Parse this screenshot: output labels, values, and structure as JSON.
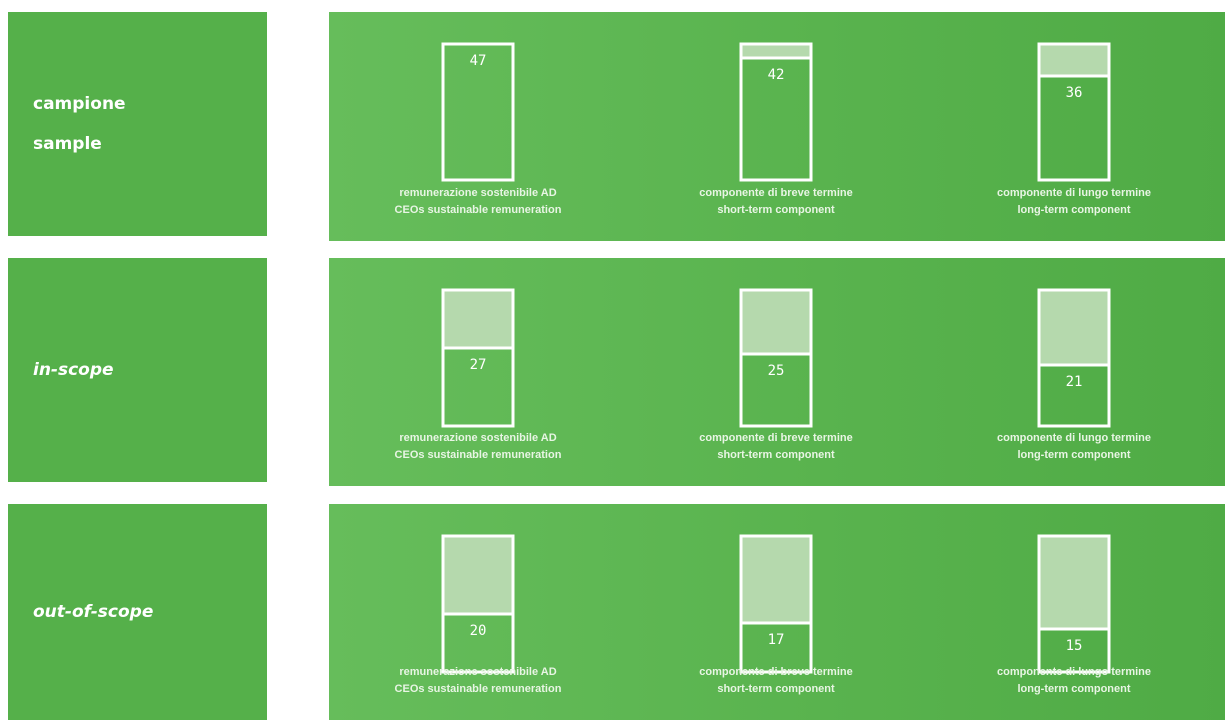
{
  "rows": [
    {
      "label_lines": [
        "campione",
        "sample"
      ],
      "italic": false
    },
    {
      "label_lines": [
        "in-scope"
      ],
      "italic": true
    },
    {
      "label_lines": [
        "out-of-scope"
      ],
      "italic": true
    }
  ],
  "captions": [
    {
      "it": "remunerazione sostenibile AD",
      "en": "CEOs sustainable remuneration"
    },
    {
      "it": "componente di breve termine",
      "en": "short-term component"
    },
    {
      "it": "componente di lungo termine",
      "en": "long-term component"
    }
  ],
  "chart_data": {
    "type": "bar",
    "categories": [
      "remunerazione sostenibile AD / CEOs sustainable remuneration",
      "componente di breve termine / short-term component",
      "componente di lungo termine / long-term component"
    ],
    "series": [
      {
        "name": "campione sample",
        "values": [
          47,
          42,
          36
        ]
      },
      {
        "name": "in-scope",
        "values": [
          27,
          25,
          21
        ]
      },
      {
        "name": "out-of-scope",
        "values": [
          20,
          17,
          15
        ]
      }
    ]
  },
  "colors": {
    "panel": "#5cb651",
    "label_box": "#55b04a",
    "unfilled": "#b5d9ad",
    "outline": "#ffffff"
  }
}
